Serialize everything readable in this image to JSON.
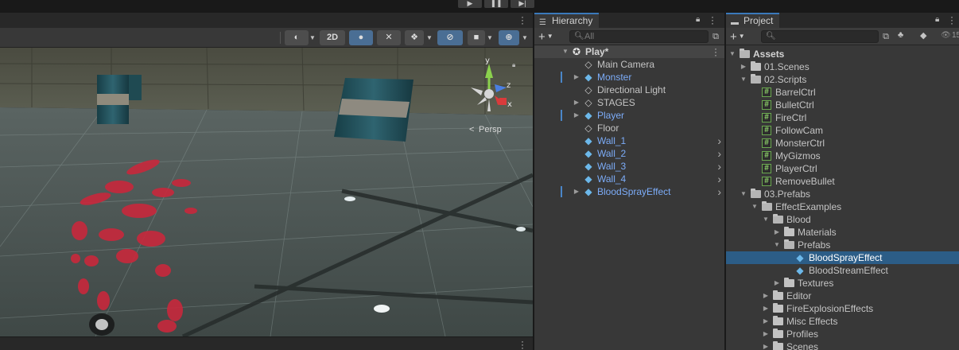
{
  "topbar": {
    "play_icon": "play-icon",
    "pause_icon": "pause-icon",
    "step_icon": "step-icon",
    "play_glyph": "▶",
    "pause_glyph": "❚❚",
    "step_glyph": "▶|"
  },
  "scene": {
    "toolbar": {
      "button_2d": "2D",
      "persp_label": "Persp"
    },
    "gizmo": {
      "x": "x",
      "y": "y",
      "z": "z"
    }
  },
  "hierarchy": {
    "tab_label": "Hierarchy",
    "add_glyph": "+",
    "search_placeholder": "All",
    "scene_name": "Play*",
    "items": [
      {
        "label": "Main Camera",
        "prefab": false,
        "expandable": false,
        "chevron": false
      },
      {
        "label": "Monster",
        "prefab": true,
        "expandable": true,
        "chevron": false
      },
      {
        "label": "Directional Light",
        "prefab": false,
        "expandable": false,
        "chevron": false
      },
      {
        "label": "STAGES",
        "prefab": false,
        "expandable": true,
        "chevron": false
      },
      {
        "label": "Player",
        "prefab": true,
        "expandable": true,
        "chevron": false
      },
      {
        "label": "Floor",
        "prefab": false,
        "expandable": false,
        "chevron": false
      },
      {
        "label": "Wall_1",
        "prefab": true,
        "expandable": false,
        "chevron": true
      },
      {
        "label": "Wall_2",
        "prefab": true,
        "expandable": false,
        "chevron": true
      },
      {
        "label": "Wall_3",
        "prefab": true,
        "expandable": false,
        "chevron": true
      },
      {
        "label": "Wall_4",
        "prefab": true,
        "expandable": false,
        "chevron": true
      },
      {
        "label": "BloodSprayEffect",
        "prefab": true,
        "expandable": true,
        "chevron": true
      }
    ]
  },
  "project": {
    "tab_label": "Project",
    "add_glyph": "+",
    "search_placeholder": "",
    "eye_count": "15",
    "root_label": "Assets",
    "tree": [
      {
        "label": "01.Scenes",
        "kind": "folder",
        "depth": 1,
        "expand": "closed"
      },
      {
        "label": "02.Scripts",
        "kind": "folder",
        "depth": 1,
        "expand": "open"
      },
      {
        "label": "BarrelCtrl",
        "kind": "script",
        "depth": 2,
        "expand": "none"
      },
      {
        "label": "BulletCtrl",
        "kind": "script",
        "depth": 2,
        "expand": "none"
      },
      {
        "label": "FireCtrl",
        "kind": "script",
        "depth": 2,
        "expand": "none"
      },
      {
        "label": "FollowCam",
        "kind": "script",
        "depth": 2,
        "expand": "none"
      },
      {
        "label": "MonsterCtrl",
        "kind": "script",
        "depth": 2,
        "expand": "none"
      },
      {
        "label": "MyGizmos",
        "kind": "script",
        "depth": 2,
        "expand": "none"
      },
      {
        "label": "PlayerCtrl",
        "kind": "script",
        "depth": 2,
        "expand": "none"
      },
      {
        "label": "RemoveBullet",
        "kind": "script",
        "depth": 2,
        "expand": "none"
      },
      {
        "label": "03.Prefabs",
        "kind": "folder",
        "depth": 1,
        "expand": "open"
      },
      {
        "label": "EffectExamples",
        "kind": "folder",
        "depth": 2,
        "expand": "open"
      },
      {
        "label": "Blood",
        "kind": "folder",
        "depth": 3,
        "expand": "open"
      },
      {
        "label": "Materials",
        "kind": "folder",
        "depth": 4,
        "expand": "closed"
      },
      {
        "label": "Prefabs",
        "kind": "folder",
        "depth": 4,
        "expand": "open"
      },
      {
        "label": "BloodSprayEffect",
        "kind": "prefab",
        "depth": 5,
        "expand": "none",
        "selected": true
      },
      {
        "label": "BloodStreamEffect",
        "kind": "prefab",
        "depth": 5,
        "expand": "none"
      },
      {
        "label": "Textures",
        "kind": "folder",
        "depth": 4,
        "expand": "closed"
      },
      {
        "label": "Editor",
        "kind": "folder",
        "depth": 3,
        "expand": "closed"
      },
      {
        "label": "FireExplosionEffects",
        "kind": "folder",
        "depth": 3,
        "expand": "closed"
      },
      {
        "label": "Misc Effects",
        "kind": "folder",
        "depth": 3,
        "expand": "closed"
      },
      {
        "label": "Profiles",
        "kind": "folder",
        "depth": 3,
        "expand": "closed"
      },
      {
        "label": "Scenes",
        "kind": "folder",
        "depth": 3,
        "expand": "closed"
      }
    ]
  },
  "colors": {
    "selection": "#2c5d87",
    "prefab_text": "#7cacf8",
    "tab_accent": "#3a79bb",
    "blood": "#c8283c"
  }
}
